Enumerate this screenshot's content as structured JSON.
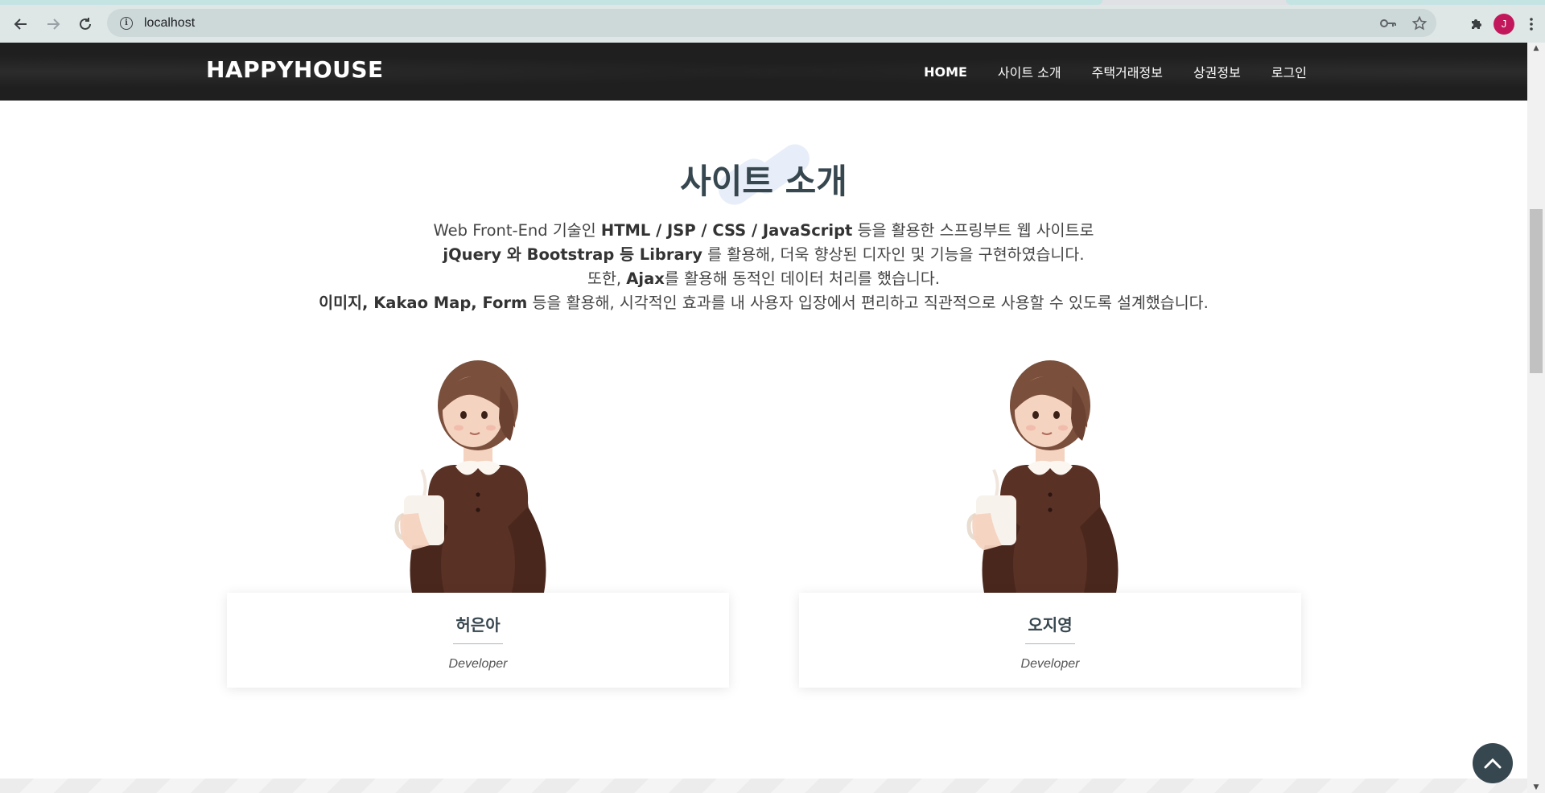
{
  "browser": {
    "url": "localhost",
    "profile_initial": "J"
  },
  "site": {
    "logo": "HAPPYHOUSE",
    "menu": [
      {
        "label": "HOME"
      },
      {
        "label": "사이트 소개"
      },
      {
        "label": "주택거래정보"
      },
      {
        "label": "상권정보"
      },
      {
        "label": "로그인"
      }
    ]
  },
  "about": {
    "title": "사이트 소개",
    "lines": [
      [
        {
          "t": "Web Front-End 기술인 "
        },
        {
          "t": "HTML / JSP / CSS / JavaScript",
          "b": true
        },
        {
          "t": " 등을 활용한 스프링부트 웹 사이트로"
        }
      ],
      [
        {
          "t": "jQuery 와 Bootstrap 등 Library",
          "b": true
        },
        {
          "t": " 를 활용해, 더욱 향상된 디자인 및 기능을 구현하였습니다."
        }
      ],
      [
        {
          "t": "또한, "
        },
        {
          "t": "Ajax",
          "b": true
        },
        {
          "t": "를 활용해 동적인 데이터 처리를 했습니다."
        }
      ],
      [
        {
          "t": "이미지, Kakao Map, Form",
          "b": true
        },
        {
          "t": " 등을 활용해, 시각적인 효과를 내 사용자 입장에서 편리하고 직관적으로 사용할 수 있도록 설계했습니다."
        }
      ]
    ]
  },
  "team": [
    {
      "name": "허은아",
      "role": "Developer"
    },
    {
      "name": "오지영",
      "role": "Developer"
    }
  ],
  "colors": {
    "header_bg": "#1f1f1f",
    "title": "#37474f",
    "sweater": "#5a3125",
    "hair": "#7a4f3c",
    "skin": "#f4d3c0"
  },
  "icons": {
    "back": "arrow-left-icon",
    "forward": "arrow-right-icon",
    "reload": "reload-icon",
    "info": "info-icon",
    "key": "key-icon",
    "star": "star-icon",
    "extensions": "puzzle-icon",
    "menu": "kebab-menu-icon",
    "top": "chevron-up-icon"
  }
}
